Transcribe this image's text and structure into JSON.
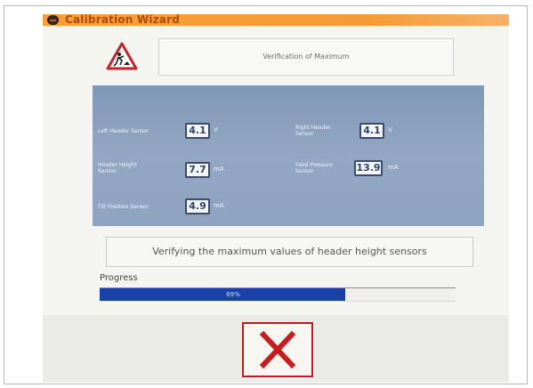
{
  "window": {
    "title": "Calibration Wizard",
    "app_icon": "app-logo-icon",
    "title_color": "#b04a10",
    "titlebar_color": "#f39c37"
  },
  "step": {
    "warning_icon": "warning-construction-icon",
    "heading": "Verification of Maximum"
  },
  "sensors": [
    {
      "label": "Left Header Sensor",
      "value": "4.1",
      "unit": "V"
    },
    {
      "label": "Right Header Sensor",
      "value": "4.1",
      "unit": "V"
    },
    {
      "label": "Header Height Sensor",
      "value": "7.7",
      "unit": "mA"
    },
    {
      "label": "Feed Pressure Sensor",
      "value": "13.9",
      "unit": "mA"
    },
    {
      "label": "Tilt Position Sensor",
      "value": "4.9",
      "unit": "mA"
    }
  ],
  "status": {
    "message": "Verifying the maximum values of header height sensors"
  },
  "progress": {
    "label": "Progress",
    "value": 69,
    "value_text": "69%",
    "fill_color": "#1842a8"
  },
  "actions": {
    "cancel_icon": "cancel-x-icon",
    "cancel_color": "#b81e1e"
  }
}
